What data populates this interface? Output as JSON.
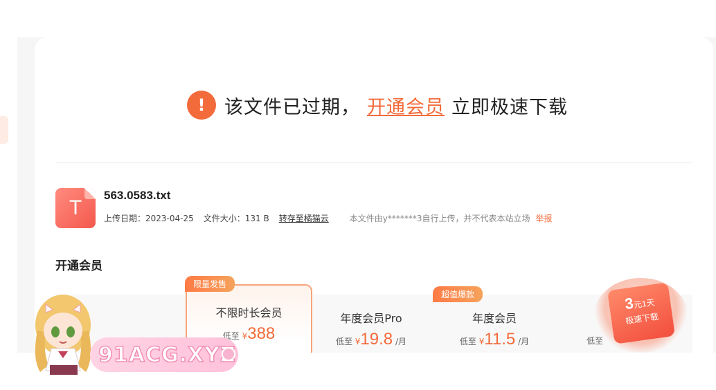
{
  "notice": {
    "icon": "warning-exclamation-icon",
    "text_before": "该文件已过期，",
    "link": "开通会员",
    "text_after": "立即极速下载",
    "accent_color": "#f36b3b"
  },
  "file": {
    "icon_letter": "T",
    "name": "563.0583.txt",
    "upload_date": "上传日期：2023-04-25",
    "file_size": "文件大小：131 B",
    "save_link": "转存至橘猫云",
    "disclaimer": "本文件由y*******3自行上传，并不代表本站立场",
    "report": "举报"
  },
  "membership": {
    "title": "开通会员",
    "plans": [
      {
        "badge": "限量发售",
        "name": "不限时长会员",
        "prefix": "低至",
        "currency": "¥",
        "price": "388",
        "unit": ""
      },
      {
        "badge": "",
        "name": "年度会员Pro",
        "prefix": "低至",
        "currency": "¥",
        "price": "19.8",
        "unit": "/月"
      },
      {
        "badge": "超值爆款",
        "name": "年度会员",
        "prefix": "低至",
        "currency": "¥",
        "price": "11.5",
        "unit": "/月"
      },
      {
        "badge": "",
        "name": "",
        "prefix": "低至",
        "currency": "",
        "price": "",
        "unit": ""
      }
    ]
  },
  "promo": {
    "big": "3",
    "big_unit": "元1天",
    "small": "极速下载"
  },
  "watermark": {
    "text": "91ACG.XYZ"
  }
}
